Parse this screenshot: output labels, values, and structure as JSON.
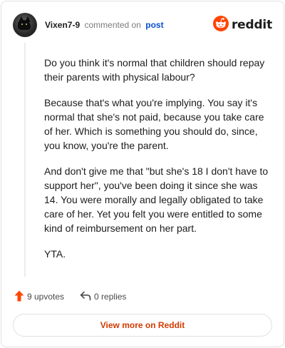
{
  "comment": {
    "username": "Vixen7-9",
    "commented_on": "commented on",
    "post_link": "post",
    "paragraphs": [
      "Do you think it's normal that children should repay their parents with physical labour?",
      "Because that's what you're implying. You say it's normal that she's not paid, because you take care of her. Which is something you should do, since, you know, you're the parent.",
      "And don't give me that \"but she's 18 I don't have to support her\", you've been doing it since she was 14. You were morally and legally obligated to take care of her. Yet you felt you were entitled to some kind of reimbursement on her part.",
      "YTA."
    ]
  },
  "brand": {
    "wordmark": "reddit",
    "icon": "reddit-snoo-icon",
    "color": "#ff4500"
  },
  "actions": {
    "upvotes_label": "9 upvotes",
    "upvote_icon": "upvote-arrow-icon",
    "upvote_color": "#ff4500",
    "replies_label": "0 replies",
    "reply_icon": "reply-arrow-icon"
  },
  "footer": {
    "view_more_label": "View more on Reddit",
    "accent": "#d23a00"
  }
}
